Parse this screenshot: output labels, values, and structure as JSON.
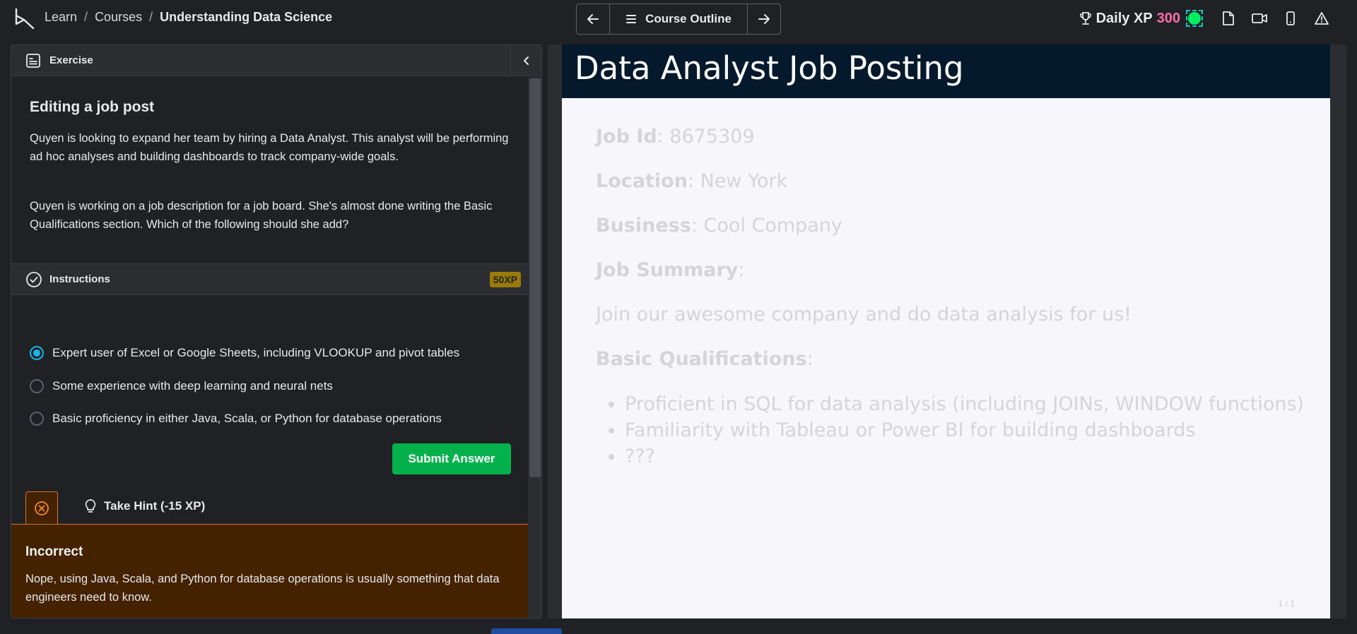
{
  "header": {
    "breadcrumbs": [
      "Learn",
      "Courses",
      "Understanding Data Science"
    ],
    "separator": "/",
    "course_outline_label": "Course Outline",
    "daily_xp_label": "Daily XP",
    "daily_xp_value": "300",
    "accent_color": "#03ef62"
  },
  "exercise": {
    "header_label": "Exercise",
    "title": "Editing a job post",
    "paragraph_1": "Quyen is looking to expand her team by hiring a Data Analyst. This analyst will be performing ad hoc analyses and building dashboards to track company-wide goals.",
    "paragraph_2": "Quyen is working on a job description for a job board. She's almost done writing the Basic Qualifications section. Which of the following should she add?"
  },
  "instructions": {
    "label": "Instructions",
    "xp_badge": "50XP",
    "options": [
      {
        "label": "Expert user of Excel or Google Sheets, including VLOOKUP and pivot tables",
        "selected": true
      },
      {
        "label": "Some experience with deep learning and neural nets",
        "selected": false
      },
      {
        "label": "Basic proficiency in either Java, Scala, or Python for database operations",
        "selected": false
      }
    ],
    "submit_label": "Submit Answer"
  },
  "hint": {
    "label": "Take Hint (-15 XP)"
  },
  "feedback": {
    "title": "Incorrect",
    "text": "Nope, using Java, Scala, and Python for database operations is usually something that data engineers need to know."
  },
  "slide": {
    "title": "Data Analyst Job Posting",
    "fields": [
      {
        "key": "Job Id",
        "value": ": 8675309"
      },
      {
        "key": "Location",
        "value": ": New York"
      },
      {
        "key": "Business",
        "value": ": Cool Company"
      },
      {
        "key": "Job Summary",
        "value": ":"
      }
    ],
    "summary": "Join our awesome company and do data analysis for us!",
    "qualifications_label": "Basic Qualifications",
    "qualifications_suffix": ":",
    "qualifications": [
      "Proficient in SQL for data analysis (including JOINs, WINDOW functions)",
      "Familiarity with Tableau or Power BI for building dashboards",
      "???"
    ],
    "page_indicator": "1 / 1"
  }
}
